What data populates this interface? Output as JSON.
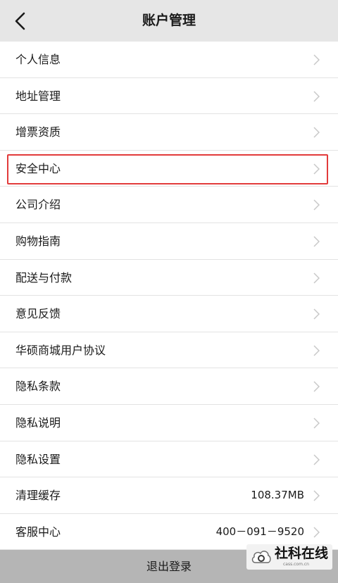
{
  "header": {
    "title": "账户管理",
    "back_icon": "chevron-left-icon"
  },
  "menu": {
    "items": [
      {
        "label": "个人信息",
        "value": ""
      },
      {
        "label": "地址管理",
        "value": ""
      },
      {
        "label": "增票资质",
        "value": ""
      },
      {
        "label": "安全中心",
        "value": "",
        "highlighted": true
      },
      {
        "label": "公司介绍",
        "value": ""
      },
      {
        "label": "购物指南",
        "value": ""
      },
      {
        "label": "配送与付款",
        "value": ""
      },
      {
        "label": "意见反馈",
        "value": ""
      },
      {
        "label": "华硕商城用户协议",
        "value": ""
      },
      {
        "label": "隐私条款",
        "value": ""
      },
      {
        "label": "隐私说明",
        "value": ""
      },
      {
        "label": "隐私设置",
        "value": ""
      },
      {
        "label": "清理缓存",
        "value": "108.37MB"
      },
      {
        "label": "客服中心",
        "value": "400－091－9520"
      }
    ],
    "chevron_icon": "chevron-right-icon"
  },
  "footer": {
    "logout_label": "退出登录"
  },
  "watermark": {
    "text": "社科在线",
    "subtext": "cass.com.cn"
  },
  "colors": {
    "header_bg": "#e6e6e6",
    "highlight_border": "#e23b3b",
    "logout_bg": "#b5b5b5",
    "divider": "#e3e3e3",
    "chevron": "#c8c8c8"
  }
}
